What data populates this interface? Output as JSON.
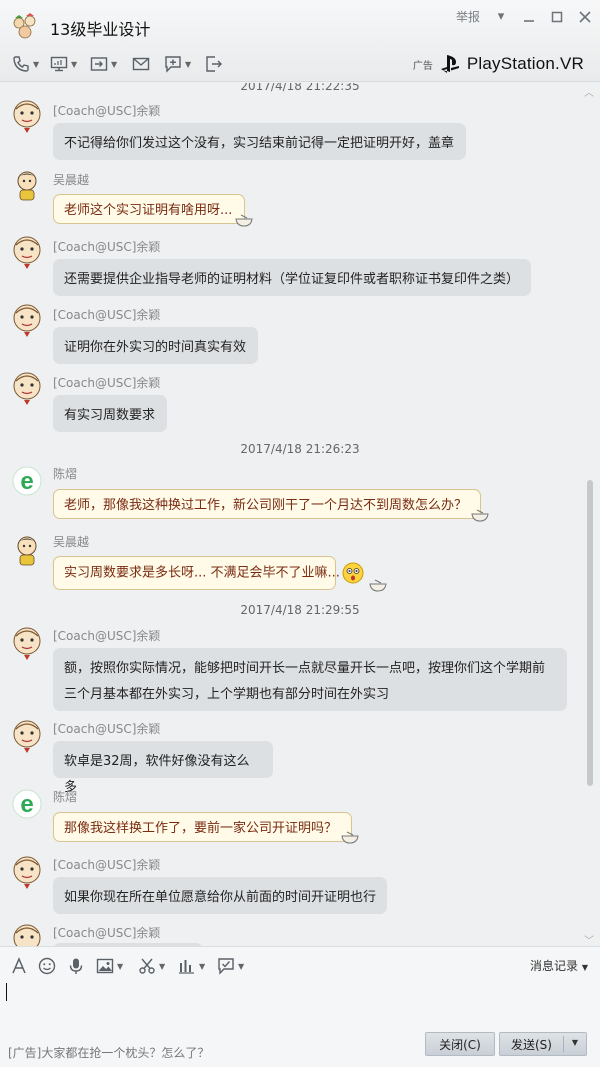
{
  "window": {
    "title": "13级毕业设计",
    "report_label": "举报"
  },
  "ad_banner": {
    "tag": "广告",
    "brand": "PlayStation.VR"
  },
  "messages": [
    {
      "type": "timestamp",
      "text": "2017/4/18 21:22:35"
    },
    {
      "type": "msg",
      "sender": "[Coach@USC]余颖",
      "text": "不记得给你们发过这个没有，实习结束前记得一定把证明开好，盖章",
      "style": "plain",
      "avatar": "cartoon-face"
    },
    {
      "type": "msg",
      "sender": "吴晨越",
      "text": "老师这个实习证明有啥用呀...",
      "style": "warm",
      "avatar": "cartoon-boy"
    },
    {
      "type": "msg",
      "sender": "[Coach@USC]余颖",
      "text": "还需要提供企业指导老师的证明材料（学位证复印件或者职称证书复印件之类）",
      "style": "plain",
      "avatar": "cartoon-face"
    },
    {
      "type": "msg",
      "sender": "[Coach@USC]余颖",
      "text": "证明你在外实习的时间真实有效",
      "style": "plain",
      "avatar": "cartoon-face"
    },
    {
      "type": "msg",
      "sender": "[Coach@USC]余颖",
      "text": "有实习周数要求",
      "style": "plain",
      "avatar": "cartoon-face"
    },
    {
      "type": "timestamp",
      "text": "2017/4/18 21:26:23"
    },
    {
      "type": "msg",
      "sender": "陈熠",
      "text": "老师，那像我这种换过工作，新公司刚干了一个月达不到周数怎么办？",
      "style": "warm",
      "avatar": "green-e"
    },
    {
      "type": "msg",
      "sender": "吴晨越",
      "text": "实习周数要求是多长呀... 不满足会毕不了业嘛...",
      "style": "warm",
      "avatar": "cartoon-boy"
    },
    {
      "type": "timestamp",
      "text": "2017/4/18 21:29:55"
    },
    {
      "type": "msg",
      "sender": "[Coach@USC]余颖",
      "text_lines": [
        "额，按照你实际情况，能够把时间开长一点就尽量开长一点吧，按理你们这个学期前",
        "三个月基本都在外实习，上个学期也有部分时间在外实习"
      ],
      "style": "plain",
      "avatar": "cartoon-face"
    },
    {
      "type": "msg",
      "sender": "[Coach@USC]余颖",
      "text": "软卓是32周，软件好像没有这么多",
      "style": "plain",
      "avatar": "cartoon-face"
    },
    {
      "type": "msg",
      "sender": "陈熠",
      "text": "那像我这样换工作了，要前一家公司开证明吗？",
      "style": "warm",
      "avatar": "green-e"
    },
    {
      "type": "msg",
      "sender": "[Coach@USC]余颖",
      "text": "如果你现在所在单位愿意给你从前面的时间开证明也行",
      "style": "plain",
      "avatar": "cartoon-face"
    },
    {
      "type": "msg",
      "sender": "[Coach@USC]余颖",
      "text": "",
      "style": "plain",
      "avatar": "cartoon-face"
    }
  ],
  "input": {
    "history_label": "消息记录",
    "ad_text": "[广告]大家都在抢一个枕头？怎么了？",
    "close_label": "关闭(C)",
    "send_label": "发送(S)"
  },
  "icons": {
    "toolbar": [
      "phone-icon",
      "screen-share-icon",
      "file-transfer-icon",
      "mail-icon",
      "add-comment-icon",
      "exit-icon"
    ],
    "input_toolbar": [
      "font-icon",
      "emoji-icon",
      "microphone-icon",
      "image-icon",
      "scissors-icon",
      "chart-icon",
      "poll-icon"
    ]
  },
  "colors": {
    "bubble_plain": "#dde0e3",
    "bubble_warm": "#fffbe8",
    "warm_text": "#7a2b10"
  }
}
